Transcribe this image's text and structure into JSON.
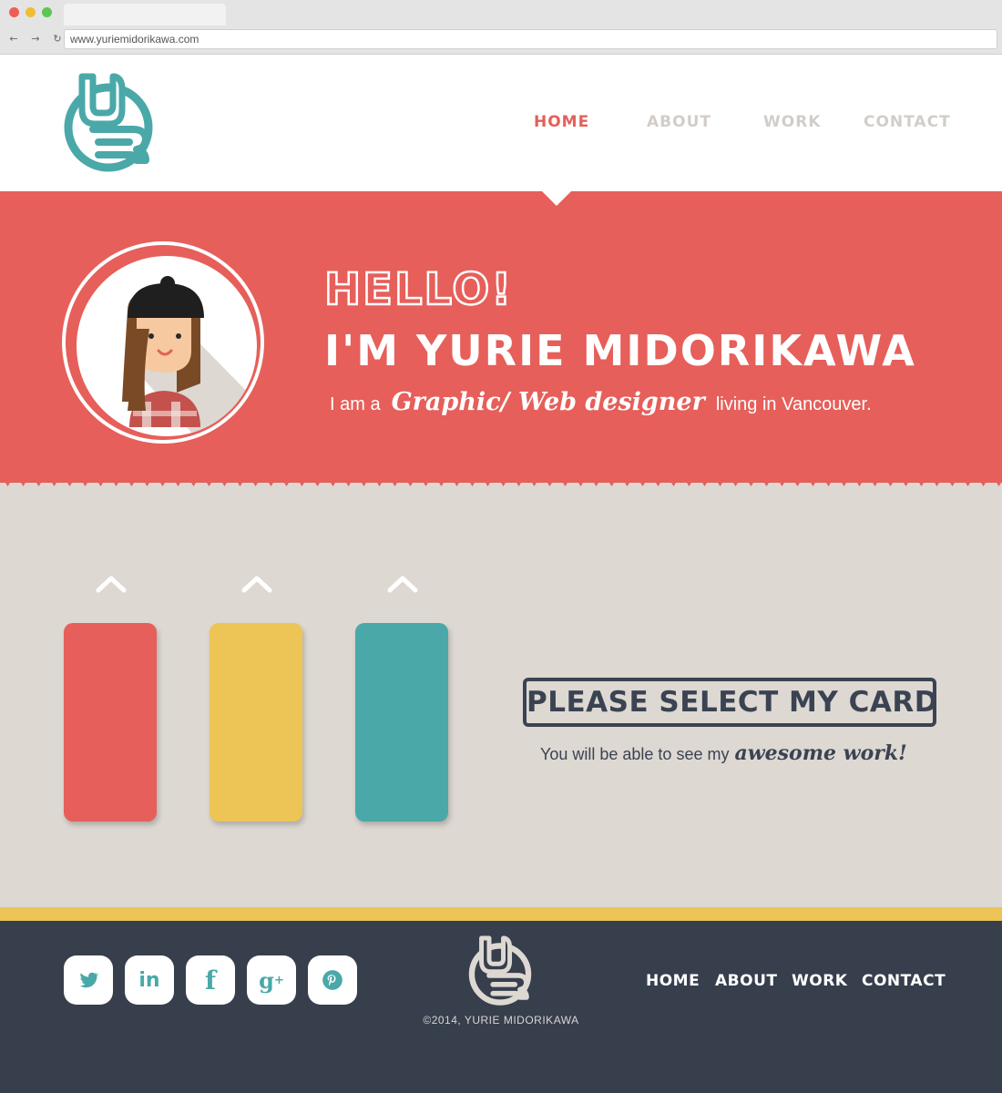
{
  "browser": {
    "url": "www.yuriemidorikawa.com",
    "back_icon": "arrow-left-icon",
    "forward_icon": "arrow-right-icon",
    "reload_icon": "reload-icon"
  },
  "header": {
    "logo_icon": "yb-monogram-logo",
    "nav": [
      {
        "label": "HOME",
        "active": true
      },
      {
        "label": "ABOUT",
        "active": false
      },
      {
        "label": "WORK",
        "active": false
      },
      {
        "label": "CONTACT",
        "active": false
      }
    ]
  },
  "hero": {
    "greeting": "HELLO!",
    "name": "I'M YURIE MIDORIKAWA",
    "tagline_prefix": "I am a",
    "tagline_script": "Graphic/ Web designer",
    "tagline_suffix": "living in Vancouver."
  },
  "cards": {
    "items": [
      {
        "color": "#e65f5a",
        "arrow_icon": "chevron-up-icon"
      },
      {
        "color": "#ecc556",
        "arrow_icon": "chevron-up-icon"
      },
      {
        "color": "#4aa8a8",
        "arrow_icon": "chevron-up-icon"
      }
    ],
    "prompt": "PLEASE SELECT MY CARD",
    "sub_prefix": "You will be able to see my",
    "sub_script": "awesome work!"
  },
  "footer": {
    "social": [
      {
        "name": "twitter-icon",
        "glyph": "t"
      },
      {
        "name": "linkedin-icon",
        "glyph": "in"
      },
      {
        "name": "facebook-icon",
        "glyph": "f"
      },
      {
        "name": "google-plus-icon",
        "glyph": "g+"
      },
      {
        "name": "pinterest-icon",
        "glyph": "p"
      }
    ],
    "copyright": "©2014, YURIE MIDORIKAWA",
    "nav": [
      "HOME",
      "ABOUT",
      "WORK",
      "CONTACT"
    ]
  },
  "colors": {
    "coral": "#e65f5a",
    "yellow": "#ecc556",
    "teal": "#4aa8a8",
    "navy": "#373f4d",
    "sand": "#ddd8d2"
  }
}
